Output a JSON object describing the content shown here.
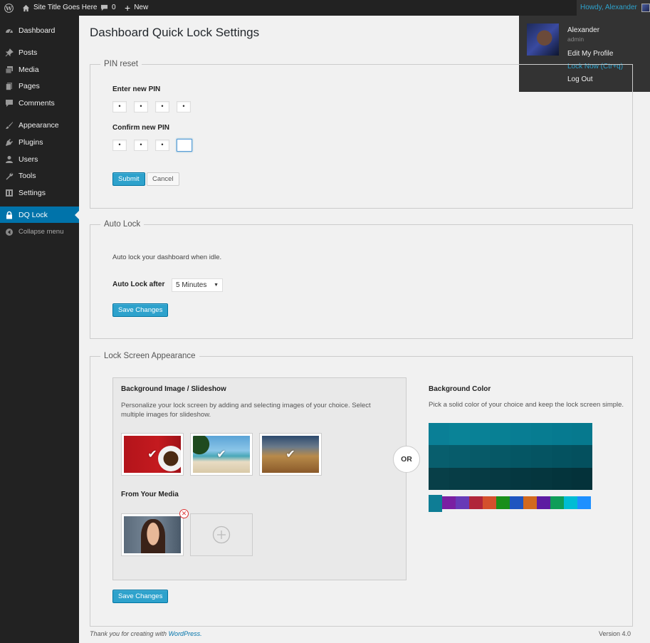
{
  "adminbar": {
    "site_title": "Site Title Goes Here",
    "comments_count": "0",
    "new_label": "New",
    "howdy": "Howdy, Alexander"
  },
  "user_menu": {
    "name": "Alexander",
    "role": "admin",
    "edit_profile": "Edit My Profile",
    "lock_now": "Lock Now (Ctr+q)",
    "log_out": "Log Out"
  },
  "sidebar": {
    "items": [
      {
        "label": "Dashboard",
        "icon": "dashboard-icon"
      },
      {
        "label": "Posts",
        "icon": "pin-icon"
      },
      {
        "label": "Media",
        "icon": "media-icon"
      },
      {
        "label": "Pages",
        "icon": "pages-icon"
      },
      {
        "label": "Comments",
        "icon": "comments-icon"
      },
      {
        "label": "Appearance",
        "icon": "brush-icon"
      },
      {
        "label": "Plugins",
        "icon": "plug-icon"
      },
      {
        "label": "Users",
        "icon": "users-icon"
      },
      {
        "label": "Tools",
        "icon": "wrench-icon"
      },
      {
        "label": "Settings",
        "icon": "settings-icon"
      },
      {
        "label": "DQ Lock",
        "icon": "lock-icon"
      },
      {
        "label": "Collapse menu",
        "icon": "collapse-icon"
      }
    ]
  },
  "page": {
    "title": "Dashboard Quick Lock Settings"
  },
  "pin_reset": {
    "legend": "PIN reset",
    "enter_label": "Enter new PIN",
    "confirm_label": "Confirm new PIN",
    "enter_values": [
      "•",
      "•",
      "•",
      "•"
    ],
    "confirm_values": [
      "•",
      "•",
      "•",
      ""
    ],
    "submit": "Submit",
    "cancel": "Cancel"
  },
  "auto_lock": {
    "legend": "Auto Lock",
    "description": "Auto lock your dashboard when idle.",
    "after_label": "Auto Lock after",
    "selected": "5 Minutes",
    "save": "Save Changes"
  },
  "appearance": {
    "legend": "Lock Screen Appearance",
    "bg_image_title": "Background Image / Slideshow",
    "bg_image_desc": "Personalize your lock screen by adding and selecting images of your choice. Select multiple images for slideshow.",
    "from_media": "From Your Media",
    "or": "OR",
    "bg_color_title": "Background Color",
    "bg_color_desc": "Pick a solid color of your choice and keep the lock screen simple.",
    "save": "Save Changes",
    "grid_colors": [
      "#0a7f96",
      "#0a8397",
      "#098196",
      "#088094",
      "#087d93",
      "#077c91",
      "#067a90",
      "#06798e",
      "#085e6d",
      "#075c6b",
      "#075a68",
      "#065866",
      "#055664",
      "#055462",
      "#045260",
      "#04505e",
      "#083f48",
      "#073d46",
      "#063b44",
      "#063942",
      "#053740",
      "#05363e",
      "#04343c",
      "#04323a"
    ],
    "strip_colors": [
      "#0e7d95",
      "#7a1fa2",
      "#673ab7",
      "#b0263a",
      "#d4502c",
      "#1a8f1a",
      "#1f55c0",
      "#d2691e",
      "#5d1ca2",
      "#0f9d58",
      "#00bcd4",
      "#1e90ff"
    ]
  },
  "footer": {
    "thanks": "Thank you for creating with ",
    "link": "WordPress.",
    "version": "Version 4.0"
  }
}
